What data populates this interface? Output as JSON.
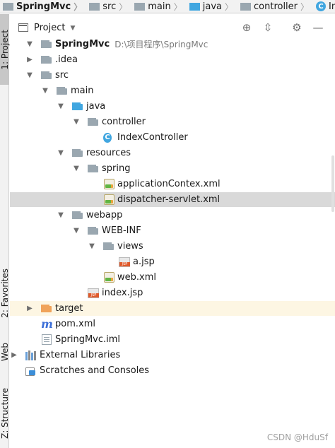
{
  "breadcrumb": {
    "items": [
      "SpringMvc",
      "src",
      "main",
      "java",
      "controller",
      "IndexController"
    ]
  },
  "tool_strip": {
    "project_tab": "1: Project",
    "favorites_tab": "2: Favorites",
    "web_tab": "Web",
    "structure_tab": "Z: Structure"
  },
  "panel": {
    "title": "Project",
    "icons": [
      "locate-icon",
      "collapse-icon",
      "gear-icon",
      "hide-icon"
    ]
  },
  "tree": {
    "root_name": "SpringMvc",
    "root_path": "D:\\项目程序\\SpringMvc",
    "idea": ".idea",
    "src": "src",
    "main": "main",
    "java": "java",
    "controller": "controller",
    "index_controller": "IndexController",
    "resources": "resources",
    "spring": "spring",
    "application_context": "applicationContex.xml",
    "dispatcher_servlet": "dispatcher-servlet.xml",
    "webapp": "webapp",
    "web_inf": "WEB-INF",
    "views": "views",
    "a_jsp": "a.jsp",
    "web_xml": "web.xml",
    "index_jsp": "index.jsp",
    "target": "target",
    "pom": "pom.xml",
    "iml": "SpringMvc.iml",
    "external_libraries": "External Libraries",
    "scratches": "Scratches and Consoles"
  },
  "watermark": "CSDN @HduSf"
}
